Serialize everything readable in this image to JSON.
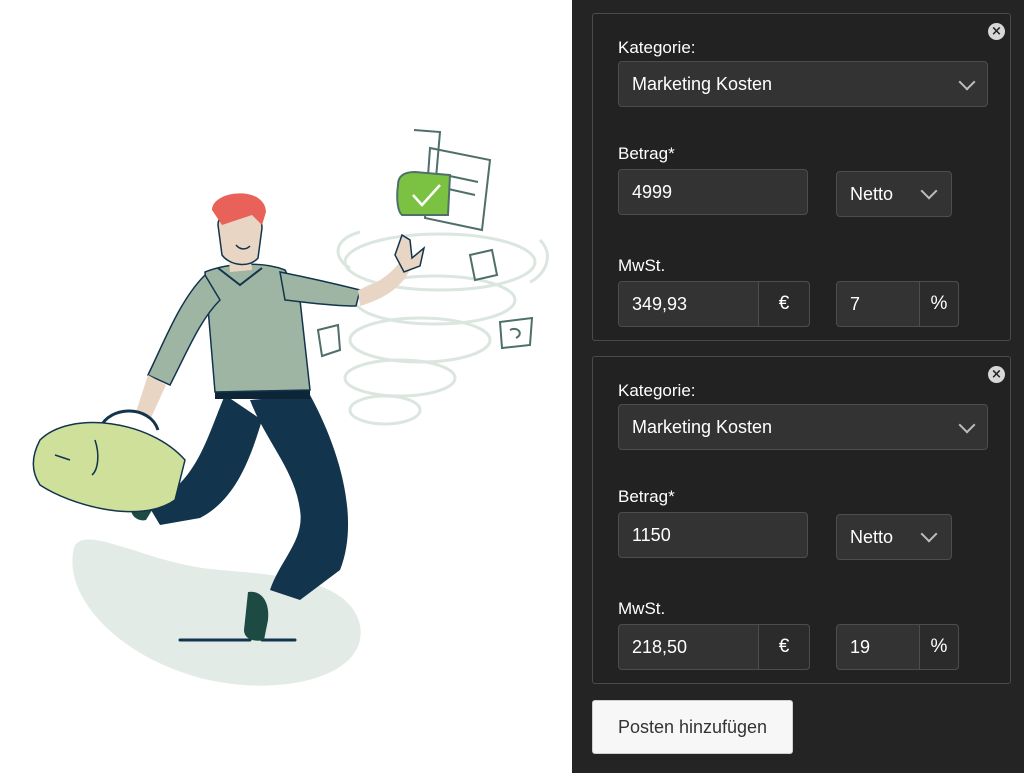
{
  "items": [
    {
      "kategorie_label": "Kategorie:",
      "kategorie_value": "Marketing Kosten",
      "betrag_label": "Betrag*",
      "betrag_value": "4999",
      "mode_value": "Netto",
      "mwst_label": "MwSt.",
      "mwst_amount": "349,93",
      "currency_symbol": "€",
      "mwst_rate": "7",
      "percent_symbol": "%",
      "remove_icon": "×"
    },
    {
      "kategorie_label": "Kategorie:",
      "kategorie_value": "Marketing Kosten",
      "betrag_label": "Betrag*",
      "betrag_value": "1150",
      "mode_value": "Netto",
      "mwst_label": "MwSt.",
      "mwst_amount": "218,50",
      "currency_symbol": "€",
      "mwst_rate": "19",
      "percent_symbol": "%",
      "remove_icon": "×"
    }
  ],
  "add_button_label": "Posten hinzufügen",
  "icons": {
    "remove": "close-circle-icon",
    "dropdown": "chevron-down-icon"
  },
  "colors": {
    "panel_bg": "#242424",
    "field_bg": "#333333",
    "border": "#4d4d4d",
    "text": "#ffffff",
    "accent_green": "#7cc242",
    "hair_red": "#e8625a",
    "shirt": "#9fb5a4",
    "trousers": "#12344d",
    "bag": "#cfe09b"
  }
}
